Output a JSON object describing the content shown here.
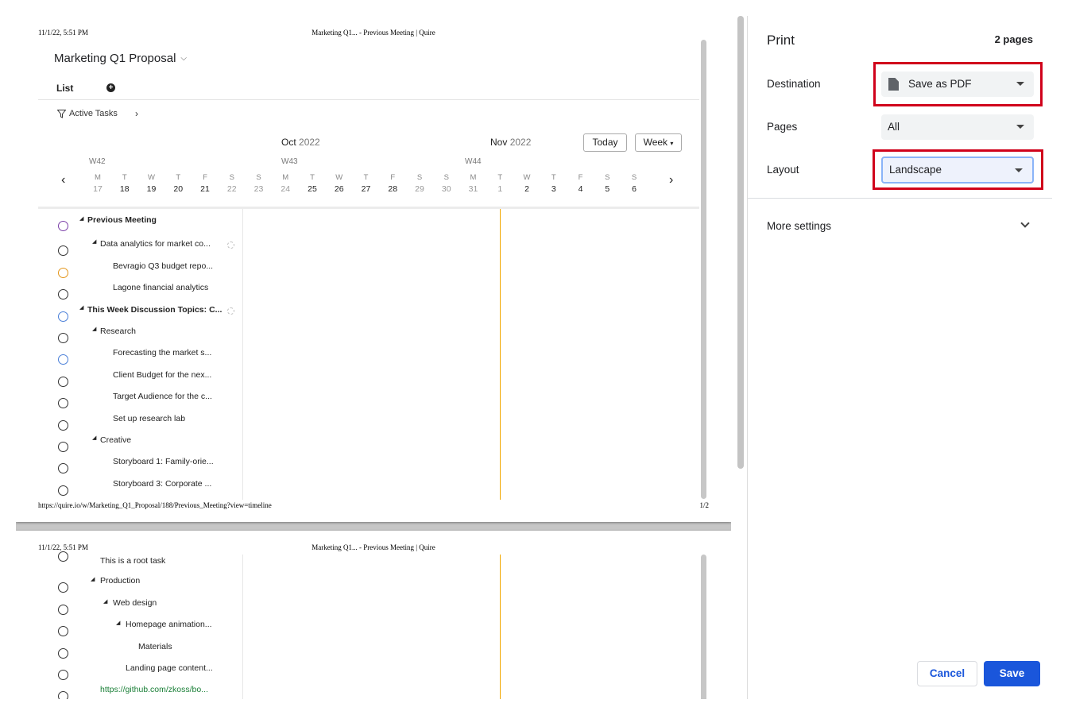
{
  "preview": {
    "page1": {
      "header_date": "11/1/22, 5:51 PM",
      "header_title": "Marketing Q1... - Previous Meeting | Quire",
      "footer_url": "https://quire.io/w/Marketing_Q1_Proposal/188/Previous_Meeting?view=timeline",
      "footer_page": "1/2",
      "project_title": "Marketing Q1 Proposal",
      "list_tab": "List",
      "add_icon": "+",
      "filter_label": "Active Tasks",
      "filter_arrow": "›",
      "months": [
        {
          "name": "Oct",
          "year": "2022"
        },
        {
          "name": "Nov",
          "year": "2022"
        }
      ],
      "today_button": "Today",
      "week_button": "Week",
      "week_caret": "▾",
      "weeks": [
        "W42",
        "W43",
        "W44"
      ],
      "prev_arrow": "‹",
      "next_arrow": "›",
      "days": [
        {
          "l": "M",
          "n": "17"
        },
        {
          "l": "T",
          "n": "18"
        },
        {
          "l": "W",
          "n": "19"
        },
        {
          "l": "T",
          "n": "20"
        },
        {
          "l": "F",
          "n": "21"
        },
        {
          "l": "S",
          "n": "22"
        },
        {
          "l": "S",
          "n": "23"
        },
        {
          "l": "M",
          "n": "24"
        },
        {
          "l": "T",
          "n": "25"
        },
        {
          "l": "W",
          "n": "26"
        },
        {
          "l": "T",
          "n": "27"
        },
        {
          "l": "F",
          "n": "28"
        },
        {
          "l": "S",
          "n": "29"
        },
        {
          "l": "S",
          "n": "30"
        },
        {
          "l": "M",
          "n": "31"
        },
        {
          "l": "T",
          "n": "1"
        },
        {
          "l": "W",
          "n": "2"
        },
        {
          "l": "T",
          "n": "3"
        },
        {
          "l": "F",
          "n": "4"
        },
        {
          "l": "S",
          "n": "5"
        },
        {
          "l": "S",
          "n": "6"
        }
      ],
      "tasks": [
        {
          "name": "Previous Meeting",
          "bold": true,
          "circle": "#7b3fa8"
        },
        {
          "name": "Data analytics for market co...",
          "bold": false,
          "circle": "#333333"
        },
        {
          "name": "Bevragio Q3 budget repo...",
          "bold": false,
          "circle": "#e3951a"
        },
        {
          "name": "Lagone financial analytics",
          "bold": false,
          "circle": "#333333"
        },
        {
          "name": "This Week Discussion Topics: C...",
          "bold": true,
          "circle": "#4a7fd8"
        },
        {
          "name": "Research",
          "bold": false,
          "circle": "#333333"
        },
        {
          "name": "Forecasting the market s...",
          "bold": false,
          "circle": "#4a7fd8"
        },
        {
          "name": "Client Budget for the nex...",
          "bold": false,
          "circle": "#333333"
        },
        {
          "name": "Target Audience for the c...",
          "bold": false,
          "circle": "#333333"
        },
        {
          "name": "Set up research lab",
          "bold": false,
          "circle": "#333333"
        },
        {
          "name": "Creative",
          "bold": false,
          "circle": "#333333"
        },
        {
          "name": "Storyboard 1: Family-orie...",
          "bold": false,
          "circle": "#333333"
        },
        {
          "name": "Storyboard 3: Corporate ...",
          "bold": false,
          "circle": "#333333"
        }
      ]
    },
    "page2": {
      "header_date": "11/1/22, 5:51 PM",
      "header_title": "Marketing Q1... - Previous Meeting | Quire",
      "tasks": [
        {
          "name": "This is a root task"
        },
        {
          "name": "Production"
        },
        {
          "name": "Web design"
        },
        {
          "name": "Homepage animation..."
        },
        {
          "name": "Materials"
        },
        {
          "name": "Landing page content..."
        },
        {
          "name": "https://github.com/zkoss/bo..."
        }
      ]
    }
  },
  "print_panel": {
    "title": "Print",
    "pages_count": "2 pages",
    "destination_label": "Destination",
    "destination_value": "Save as PDF",
    "pages_label": "Pages",
    "pages_value": "All",
    "layout_label": "Layout",
    "layout_value": "Landscape",
    "more_settings": "More settings",
    "cancel": "Cancel",
    "save": "Save",
    "highlight_color": "#d0021b",
    "accent_color": "#1a56db"
  }
}
